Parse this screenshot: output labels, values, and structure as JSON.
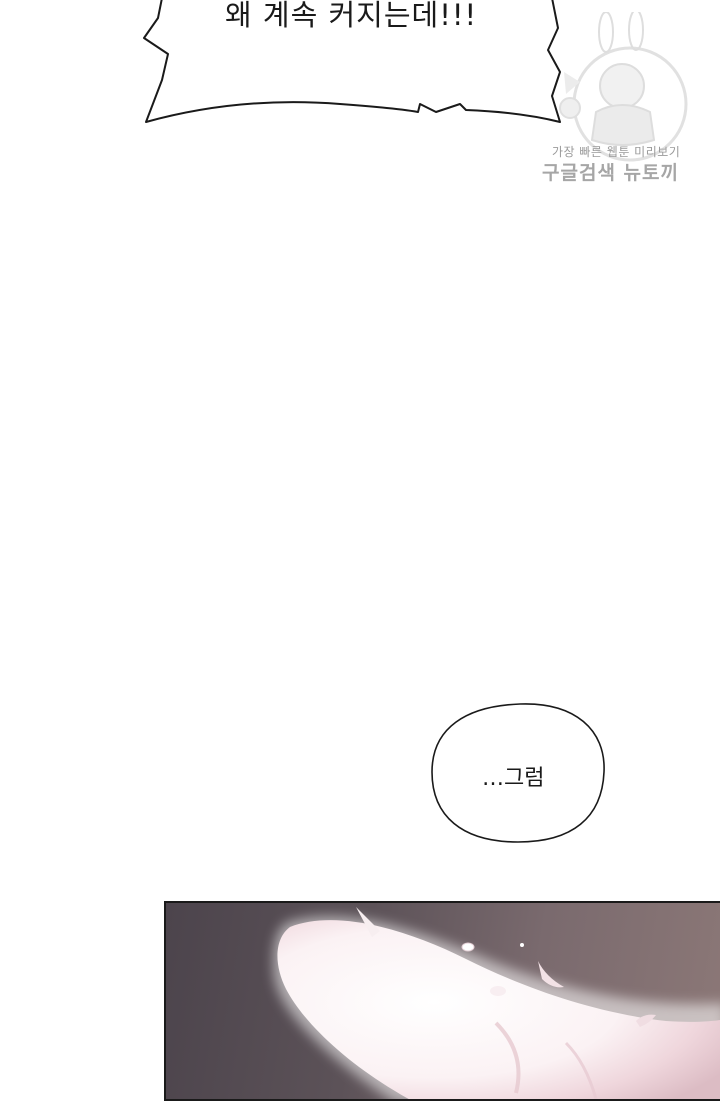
{
  "dialogue": {
    "shout": "왜 계속 커지는데!!!",
    "reply": "…그럼"
  },
  "watermark": {
    "line1": "가장 빠른 웹툰 미리보기",
    "line2": "구글검색 뉴토끼"
  },
  "colors": {
    "background": "#ffffff",
    "ink": "#1a1a1a",
    "panel_dark": "#4c444c",
    "panel_light": "#8c7877",
    "glow": "#ffffff"
  }
}
